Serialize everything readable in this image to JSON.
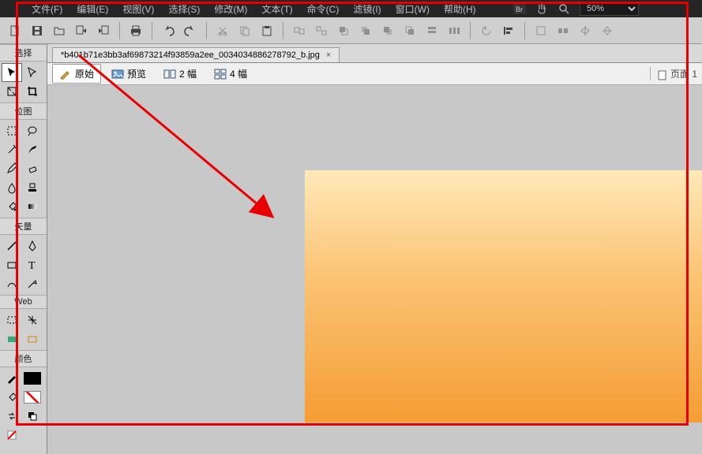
{
  "menu": {
    "file": "文件(F)",
    "edit": "编辑(E)",
    "view": "视图(V)",
    "select": "选择(S)",
    "modify": "修改(M)",
    "text": "文本(T)",
    "command": "命令(C)",
    "filter": "滤镜(I)",
    "window": "窗口(W)",
    "help": "帮助(H)"
  },
  "zoom": "50%",
  "doc": {
    "tab_title": "*b401b71e3bb3af69873214f93859a2ee_0034034886278792_b.jpg",
    "close": "×"
  },
  "view_tabs": {
    "original": "原始",
    "preview": "预览",
    "two_up": "2 幅",
    "four_up": "4 幅"
  },
  "page_label": "页面 1",
  "tool_sections": {
    "select": "选择",
    "bitmap": "位图",
    "vector": "矢量",
    "web": "Web",
    "colors": "颜色"
  }
}
